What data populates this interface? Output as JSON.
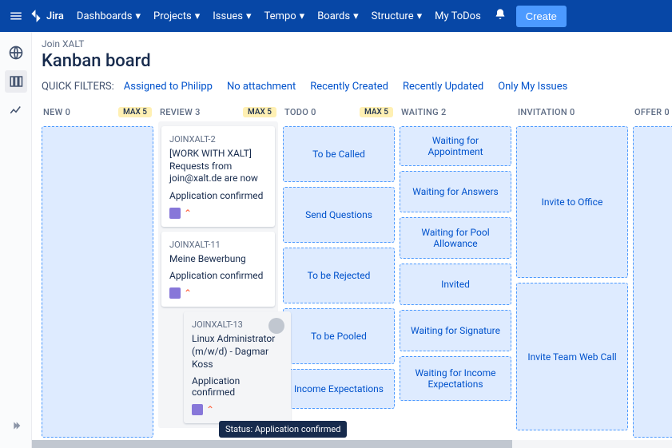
{
  "topbar": {
    "logo": "Jira",
    "nav": [
      "Dashboards",
      "Projects",
      "Issues",
      "Tempo",
      "Boards",
      "Structure",
      "My ToDos"
    ],
    "create": "Create"
  },
  "breadcrumb": "Join XALT",
  "title": "Kanban board",
  "filters": {
    "label": "QUICK FILTERS:",
    "items": [
      "Assigned to Philipp",
      "No attachment",
      "Recently Created",
      "Recently Updated",
      "Only My Issues"
    ]
  },
  "columns": {
    "new": {
      "name": "NEW",
      "count": "0",
      "max": "MAX 5"
    },
    "review": {
      "name": "REVIEW",
      "count": "3",
      "max": "MAX 5"
    },
    "todo": {
      "name": "TODO",
      "count": "0",
      "max": "MAX 5"
    },
    "waiting": {
      "name": "WAITING",
      "count": "2"
    },
    "invitation": {
      "name": "INVITATION",
      "count": "0"
    },
    "offer": {
      "name": "OFFER",
      "count": "0"
    }
  },
  "cards": [
    {
      "key": "JOINXALT-2",
      "summary": "[WORK WITH XALT] Requests from join@xalt.de are now",
      "status": "Application confirmed"
    },
    {
      "key": "JOINXALT-11",
      "summary": "Meine Bewerbung",
      "status": "Application confirmed"
    },
    {
      "key": "JOINXALT-13",
      "summary": "Linux Administrator (m/w/d) - Dagmar Koss",
      "status": "Application confirmed"
    }
  ],
  "todo_transitions": [
    "To be Called",
    "Send Questions",
    "To be Rejected",
    "To be Pooled",
    "Income Expectations"
  ],
  "waiting_transitions": [
    "Waiting for Appointment",
    "Waiting for Answers",
    "Waiting for Pool Allowance",
    "Invited",
    "Waiting for Signature",
    "Waiting for Income Expectations"
  ],
  "invitation_transitions": [
    "Invite to Office",
    "Invite Team Web Call"
  ],
  "tooltip": "Status: Application confirmed"
}
